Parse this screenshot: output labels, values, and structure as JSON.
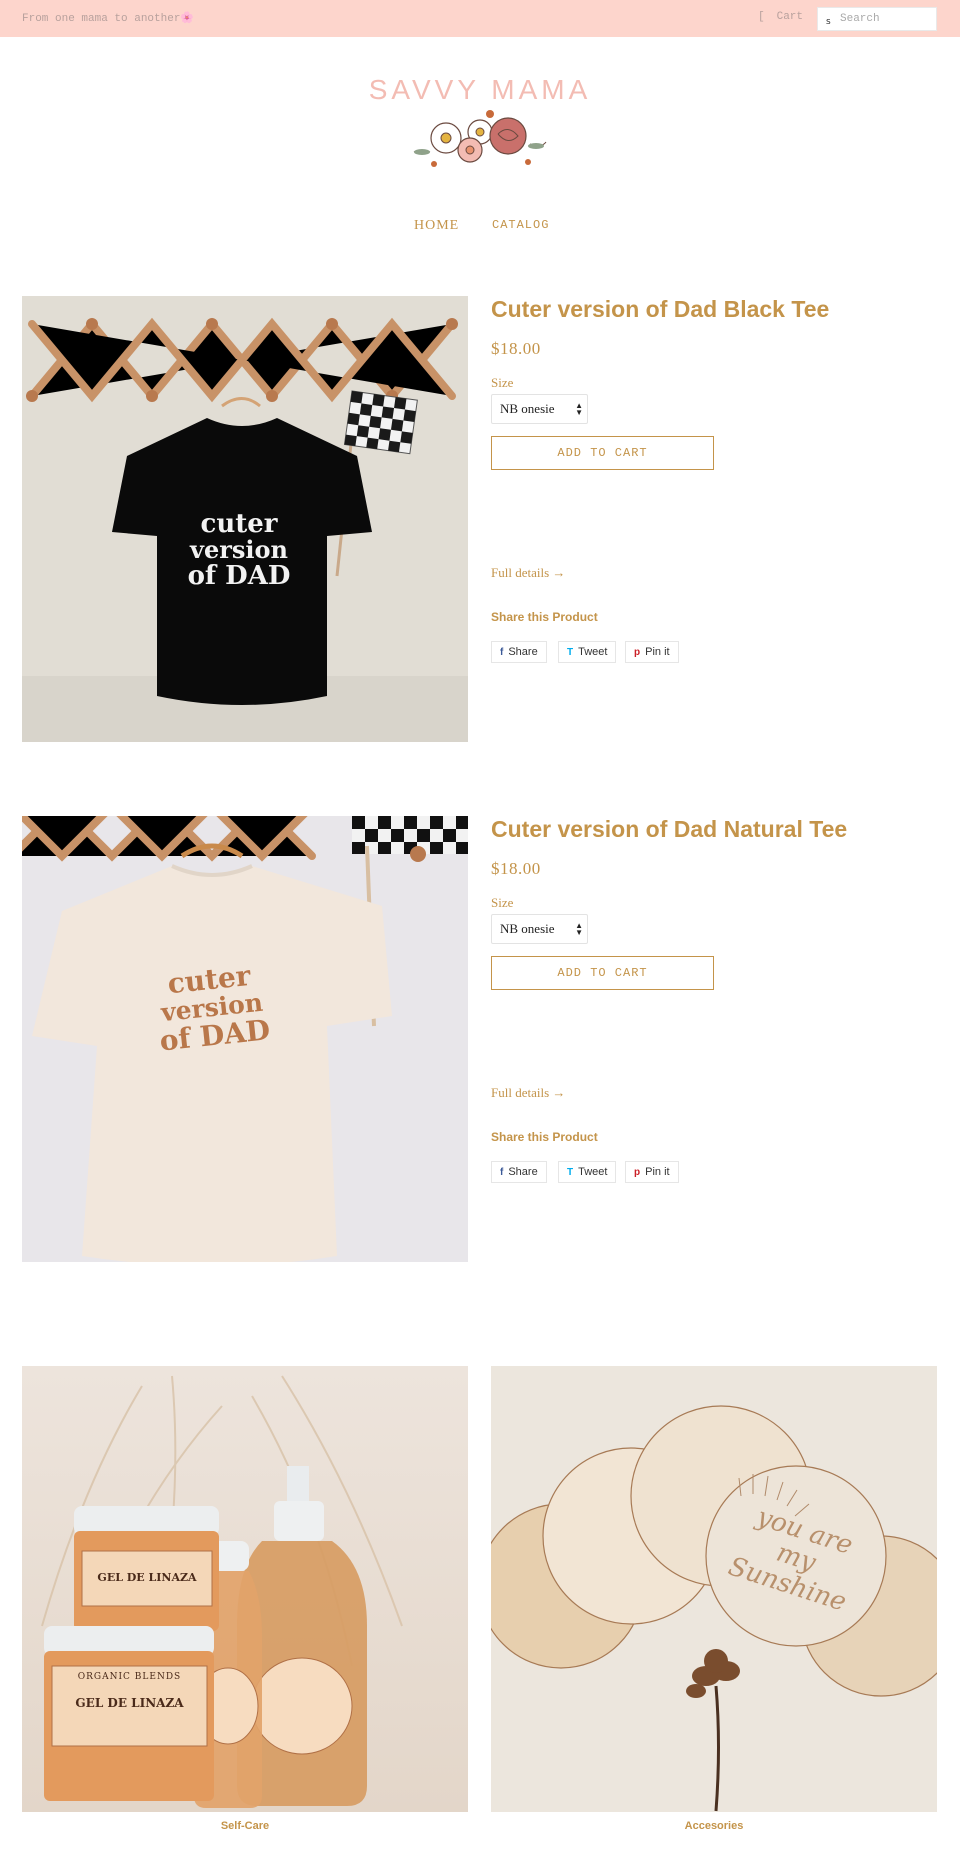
{
  "announcement": {
    "message": "From one mama to another🌸",
    "cart_label": "Cart",
    "cart_icon": "cart-icon",
    "search_placeholder": "Search",
    "search_icon": "search-icon"
  },
  "logo": {
    "text": "SAVVY MAMA"
  },
  "nav": {
    "items": [
      {
        "label": "HOME"
      },
      {
        "label": "CATALOG"
      }
    ]
  },
  "products": [
    {
      "title": "Cuter version of Dad Black Tee",
      "price": "$18.00",
      "size_label": "Size",
      "size_selected": "NB onesie",
      "add_to_cart": "ADD TO CART",
      "full_details": "Full details →",
      "share_title": "Share this Product",
      "share": {
        "facebook": "Share",
        "twitter": "Tweet",
        "pinterest": "Pin it"
      },
      "graphic_text": [
        "cuter",
        "version",
        "of DAD"
      ],
      "shirt_color": "#0a0a0a"
    },
    {
      "title": "Cuter version of Dad Natural Tee",
      "price": "$18.00",
      "size_label": "Size",
      "size_selected": "NB onesie",
      "add_to_cart": "ADD TO CART",
      "full_details": "Full details →",
      "share_title": "Share this Product",
      "share": {
        "facebook": "Share",
        "twitter": "Tweet",
        "pinterest": "Pin it"
      },
      "graphic_text": [
        "cuter",
        "version",
        "of DAD"
      ],
      "shirt_color": "#f4eadf"
    }
  ],
  "collections": [
    {
      "label": "Self-Care",
      "product_text": [
        "GEL DE LINAZA",
        "ORGANIC BLENDS"
      ]
    },
    {
      "label": "Accesories",
      "product_text": [
        "you are my Sunshine"
      ]
    }
  ],
  "colors": {
    "accent": "#c4944a",
    "announcement_bg": "#fdd5cc",
    "logo": "#f3bcb3"
  }
}
